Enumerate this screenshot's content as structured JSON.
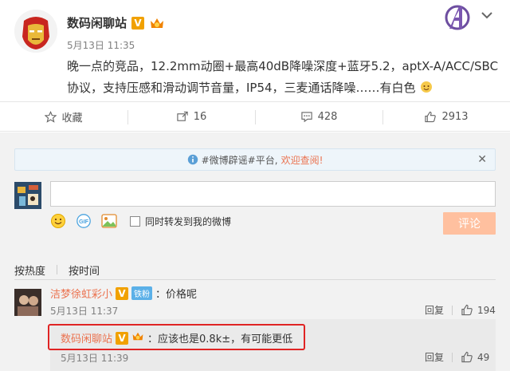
{
  "post": {
    "author": "数码闲聊站",
    "verified_mark": "V",
    "time": "5月13日 11:35",
    "text": "晚一点的竞品，12.2mm动圈+最高40dB降噪深度+蓝牙5.2，aptX-A/ACC/SBC协议，支持压感和滑动调节音量，IP54，三麦通话降噪……有白色"
  },
  "actions": {
    "favorite": "收藏",
    "forward_count": "16",
    "comment_count": "428",
    "like_count": "2913"
  },
  "notice": {
    "prefix": "#微博辟谣#平台,",
    "link": "欢迎查阅!"
  },
  "composer": {
    "sync_label": "同时转发到我的微博",
    "submit": "评论",
    "gif_label": "GIF"
  },
  "sort": {
    "hot": "按热度",
    "time": "按时间"
  },
  "comment": {
    "user": "洁梦徐虹彩小",
    "verified_mark": "V",
    "badge": "铁粉",
    "text": "：价格呢",
    "time": "5月13日 11:37",
    "reply_label": "回复",
    "likes": "194"
  },
  "reply": {
    "user": "数码闲聊站",
    "verified_mark": "V",
    "text": "：应该也是0.8k±，有可能更低",
    "time": "5月13日 11:39",
    "reply_label": "回复",
    "likes": "49"
  },
  "colors": {
    "accent": "#eb7350",
    "vip": "#f1a100",
    "submit_disabled": "#ffc09f",
    "highlight": "#e02424"
  }
}
